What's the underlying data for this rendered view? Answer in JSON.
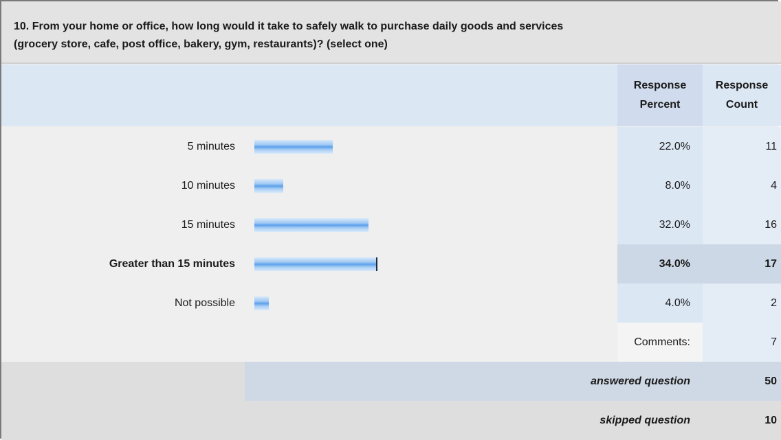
{
  "question": {
    "line1": "10. From your home or office, how long would it take to safely walk to purchase daily goods and services",
    "line2": "(grocery store, cafe, post office, bakery, gym, restaurants)? (select one)"
  },
  "headers": {
    "percent_line1": "Response",
    "percent_line2": "Percent",
    "count_line1": "Response",
    "count_line2": "Count"
  },
  "chart_data": {
    "type": "bar",
    "orientation": "horizontal",
    "categories": [
      "5 minutes",
      "10 minutes",
      "15 minutes",
      "Greater than 15 minutes",
      "Not possible"
    ],
    "values": [
      22.0,
      8.0,
      32.0,
      34.0,
      4.0
    ],
    "percent_labels": [
      "22.0%",
      "8.0%",
      "32.0%",
      "34.0%",
      "4.0%"
    ],
    "counts": [
      "11",
      "4",
      "16",
      "17",
      "2"
    ],
    "highlighted_category": "Greater than 15 minutes",
    "xlim": [
      0,
      100
    ]
  },
  "comments": {
    "label": "Comments:",
    "value": "7"
  },
  "footer": {
    "answered_label": "answered question",
    "answered_value": "50",
    "skipped_label": "skipped question",
    "skipped_value": "10"
  },
  "colors": {
    "bar": "#5aa0ea",
    "header_bg": "#dce7f4",
    "highlight_bg": "#ccd8e6"
  }
}
